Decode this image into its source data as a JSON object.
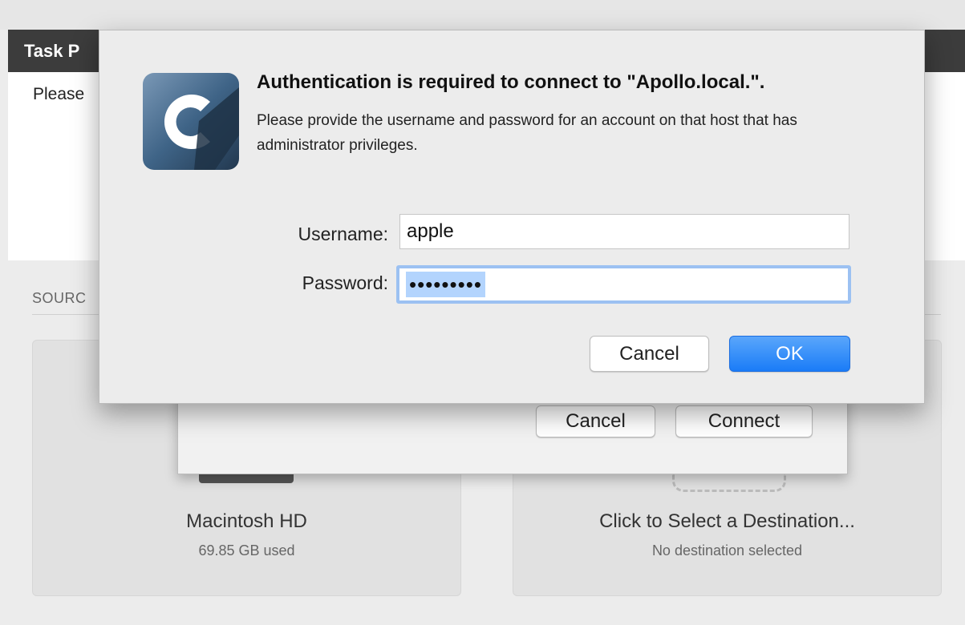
{
  "background": {
    "window_title": "Task P",
    "prompt_text": "Please",
    "source_label": "SOURC",
    "source_card": {
      "name": "Macintosh HD",
      "sub": "69.85 GB used"
    },
    "destination_card": {
      "name": "Click to Select a Destination...",
      "sub": "No destination selected"
    }
  },
  "connect_sheet": {
    "cancel_label": "Cancel",
    "connect_label": "Connect"
  },
  "auth_dialog": {
    "heading": "Authentication is required to connect to \"Apollo.local.\".",
    "body": "Please provide the username and password for an account on that host that has administrator privileges.",
    "username_label": "Username:",
    "username_value": "apple",
    "password_label": "Password:",
    "password_mask": "•••••••••",
    "cancel_label": "Cancel",
    "ok_label": "OK"
  },
  "colors": {
    "accent": "#1a7cf7",
    "title_bar": "#3c3c3c",
    "selection": "#b3d4fd"
  }
}
